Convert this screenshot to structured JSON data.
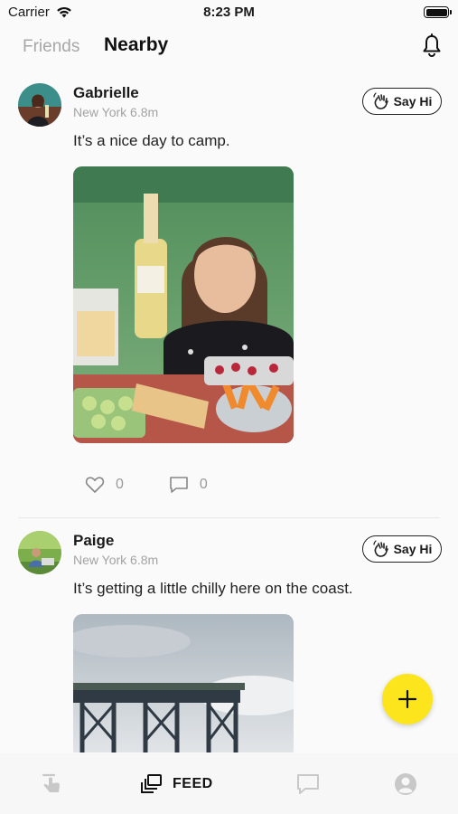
{
  "status_bar": {
    "carrier": "Carrier",
    "time": "8:23 PM"
  },
  "header": {
    "tabs": [
      {
        "label": "Friends",
        "active": false
      },
      {
        "label": "Nearby",
        "active": true
      }
    ]
  },
  "posts": [
    {
      "author": "Gabrielle",
      "location": "New York 6.8m",
      "say_hi_label": "Say Hi",
      "text": "It’s a nice day to camp.",
      "likes": "0",
      "comments": "0"
    },
    {
      "author": "Paige",
      "location": "New York 6.8m",
      "say_hi_label": "Say Hi",
      "text": "It’s getting a little chilly here on the coast."
    }
  ],
  "tab_bar": {
    "items": [
      {
        "icon": "tap-icon"
      },
      {
        "icon": "feed-icon",
        "label": "FEED",
        "active": true
      },
      {
        "icon": "chat-icon"
      },
      {
        "icon": "profile-icon"
      }
    ]
  },
  "colors": {
    "fab": "#fce51c",
    "muted_text": "#a3a3a3",
    "inactive_icon": "#c8c8c8"
  }
}
